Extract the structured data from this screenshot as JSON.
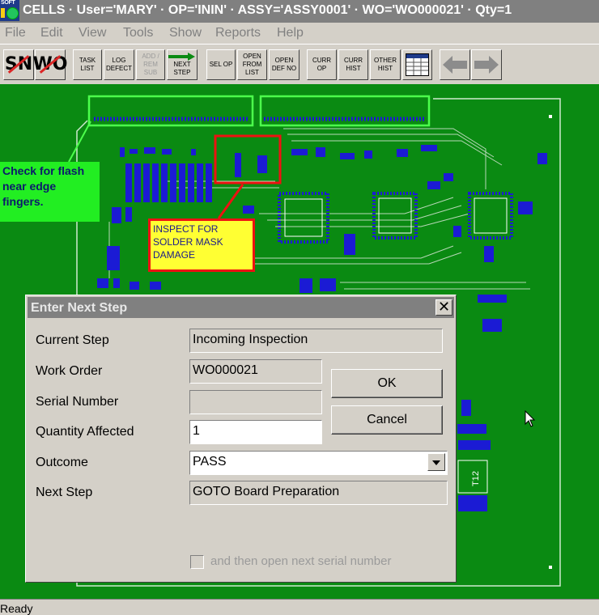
{
  "titlebar": {
    "logo_text": "SOFT",
    "title": "CELLS · User='MARY' · OP='ININ' · ASSY='ASSY0001' · WO='WO000021' · Qty=1"
  },
  "menubar": {
    "items": [
      "File",
      "Edit",
      "View",
      "Tools",
      "Show",
      "Reports",
      "Help"
    ]
  },
  "toolbar": {
    "sn_label": "SN",
    "wo_label": "WO",
    "buttons": [
      {
        "label": "TASK\nLIST",
        "enabled": true
      },
      {
        "label": "LOG\nDEFECT",
        "enabled": true
      },
      {
        "label": "ADD /\nREM\nSUB",
        "enabled": false
      },
      {
        "label": "NEXT\nSTEP",
        "enabled": true
      },
      {
        "label": "SEL OP",
        "enabled": true
      },
      {
        "label": "OPEN\nFROM\nLIST",
        "enabled": true
      },
      {
        "label": "OPEN\nDEF NO",
        "enabled": true
      },
      {
        "label": "CURR\nOP",
        "enabled": true
      },
      {
        "label": "CURR\nHIST",
        "enabled": true
      },
      {
        "label": "OTHER\nHIST",
        "enabled": true
      }
    ],
    "icons": [
      "grid-view-icon",
      "back-arrow-icon",
      "forward-arrow-icon"
    ]
  },
  "board": {
    "background_color": "#0a8a12",
    "callout_flash": "Check for flash near edge fingers.",
    "callout_mask": "INSPECT FOR SOLDER MASK DAMAGE",
    "label_t12": "T12"
  },
  "dialog": {
    "title": "Enter Next Step",
    "close_glyph": "✕",
    "fields": {
      "current_step": {
        "label": "Current Step",
        "value": "Incoming Inspection"
      },
      "work_order": {
        "label": "Work Order",
        "value": "WO000021"
      },
      "serial_number": {
        "label": "Serial Number",
        "value": ""
      },
      "quantity_affected": {
        "label": "Quantity Affected",
        "value": "1"
      },
      "outcome": {
        "label": "Outcome",
        "value": "PASS"
      },
      "next_step": {
        "label": "Next Step",
        "value": "GOTO Board Preparation"
      }
    },
    "ok_label": "OK",
    "cancel_label": "Cancel",
    "checkbox_label": "and then open next serial number",
    "checkbox_checked": false
  },
  "statusbar": {
    "text": "Ready"
  }
}
